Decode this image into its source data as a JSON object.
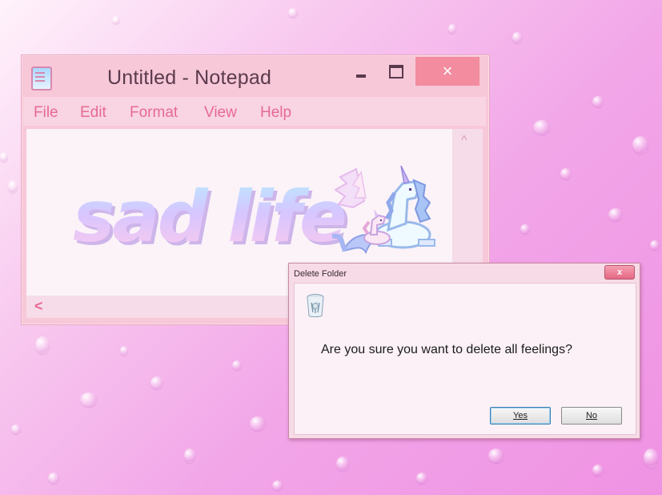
{
  "notepad": {
    "title": "Untitled - Notepad",
    "close_glyph": "×",
    "menu": [
      "File",
      "Edit",
      "Format",
      "View",
      "Help"
    ],
    "content": "sad life",
    "scroll_up": "^",
    "scroll_left": "<"
  },
  "dialog": {
    "title": "Delete Folder",
    "close_glyph": "x",
    "icon": "recycle-bin-icon",
    "message": "Are you sure you want to delete all feelings?",
    "yes_label": "Yes",
    "no_label": "No"
  },
  "colors": {
    "accent_pink": "#e66a94",
    "close_button": "#f28c9e",
    "background": "#f2a6e8"
  }
}
